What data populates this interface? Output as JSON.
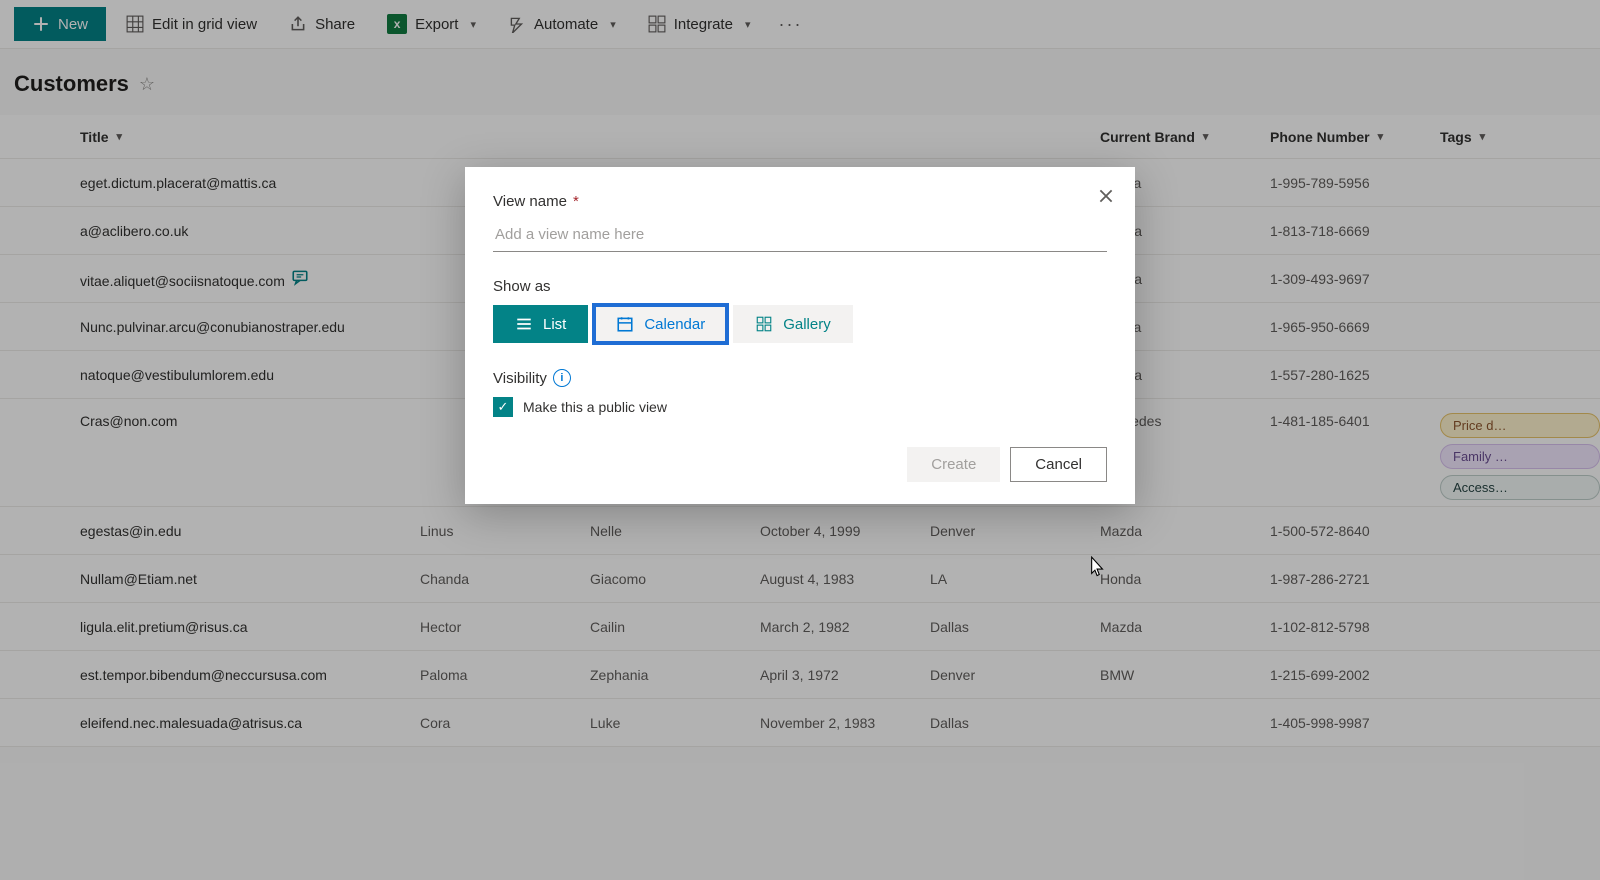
{
  "toolbar": {
    "new_label": "New",
    "edit_grid_label": "Edit in grid view",
    "share_label": "Share",
    "export_label": "Export",
    "automate_label": "Automate",
    "integrate_label": "Integrate"
  },
  "page": {
    "title": "Customers"
  },
  "columns": {
    "title": "Title",
    "first": "",
    "last": "",
    "date": "",
    "city": "",
    "brand": "Current Brand",
    "phone": "Phone Number",
    "tags": "Tags"
  },
  "rows": [
    {
      "title": "eget.dictum.placerat@mattis.ca",
      "brand": "Honda",
      "phone": "1-995-789-5956",
      "comment": false
    },
    {
      "title": "a@aclibero.co.uk",
      "brand": "Mazda",
      "phone": "1-813-718-6669",
      "comment": false
    },
    {
      "title": "vitae.aliquet@sociisnatoque.com",
      "brand": "Mazda",
      "phone": "1-309-493-9697",
      "comment": true
    },
    {
      "title": "Nunc.pulvinar.arcu@conubianostraper.edu",
      "brand": "Honda",
      "phone": "1-965-950-6669",
      "comment": false
    },
    {
      "title": "natoque@vestibulumlorem.edu",
      "brand": "Mazda",
      "phone": "1-557-280-1625",
      "comment": false
    },
    {
      "title": "Cras@non.com",
      "brand": "Mercedes",
      "phone": "1-481-185-6401",
      "comment": false,
      "tall": true,
      "tags": [
        "Price d…",
        "Family …",
        "Access…"
      ]
    },
    {
      "title": "egestas@in.edu",
      "first": "Linus",
      "last": "Nelle",
      "date": "October 4, 1999",
      "city": "Denver",
      "brand": "Mazda",
      "phone": "1-500-572-8640",
      "comment": false
    },
    {
      "title": "Nullam@Etiam.net",
      "first": "Chanda",
      "last": "Giacomo",
      "date": "August 4, 1983",
      "city": "LA",
      "brand": "Honda",
      "phone": "1-987-286-2721",
      "comment": false
    },
    {
      "title": "ligula.elit.pretium@risus.ca",
      "first": "Hector",
      "last": "Cailin",
      "date": "March 2, 1982",
      "city": "Dallas",
      "brand": "Mazda",
      "phone": "1-102-812-5798",
      "comment": false
    },
    {
      "title": "est.tempor.bibendum@neccursusa.com",
      "first": "Paloma",
      "last": "Zephania",
      "date": "April 3, 1972",
      "city": "Denver",
      "brand": "BMW",
      "phone": "1-215-699-2002",
      "comment": false
    },
    {
      "title": "eleifend.nec.malesuada@atrisus.ca",
      "first": "Cora",
      "last": "Luke",
      "date": "November 2, 1983",
      "city": "Dallas",
      "brand": "",
      "phone": "1-405-998-9987",
      "comment": false
    }
  ],
  "modal": {
    "view_name_label": "View name",
    "view_name_placeholder": "Add a view name here",
    "show_as_label": "Show as",
    "option_list": "List",
    "option_calendar": "Calendar",
    "option_gallery": "Gallery",
    "visibility_label": "Visibility",
    "public_view_label": "Make this a public view",
    "create_label": "Create",
    "cancel_label": "Cancel",
    "public_checked": true
  }
}
